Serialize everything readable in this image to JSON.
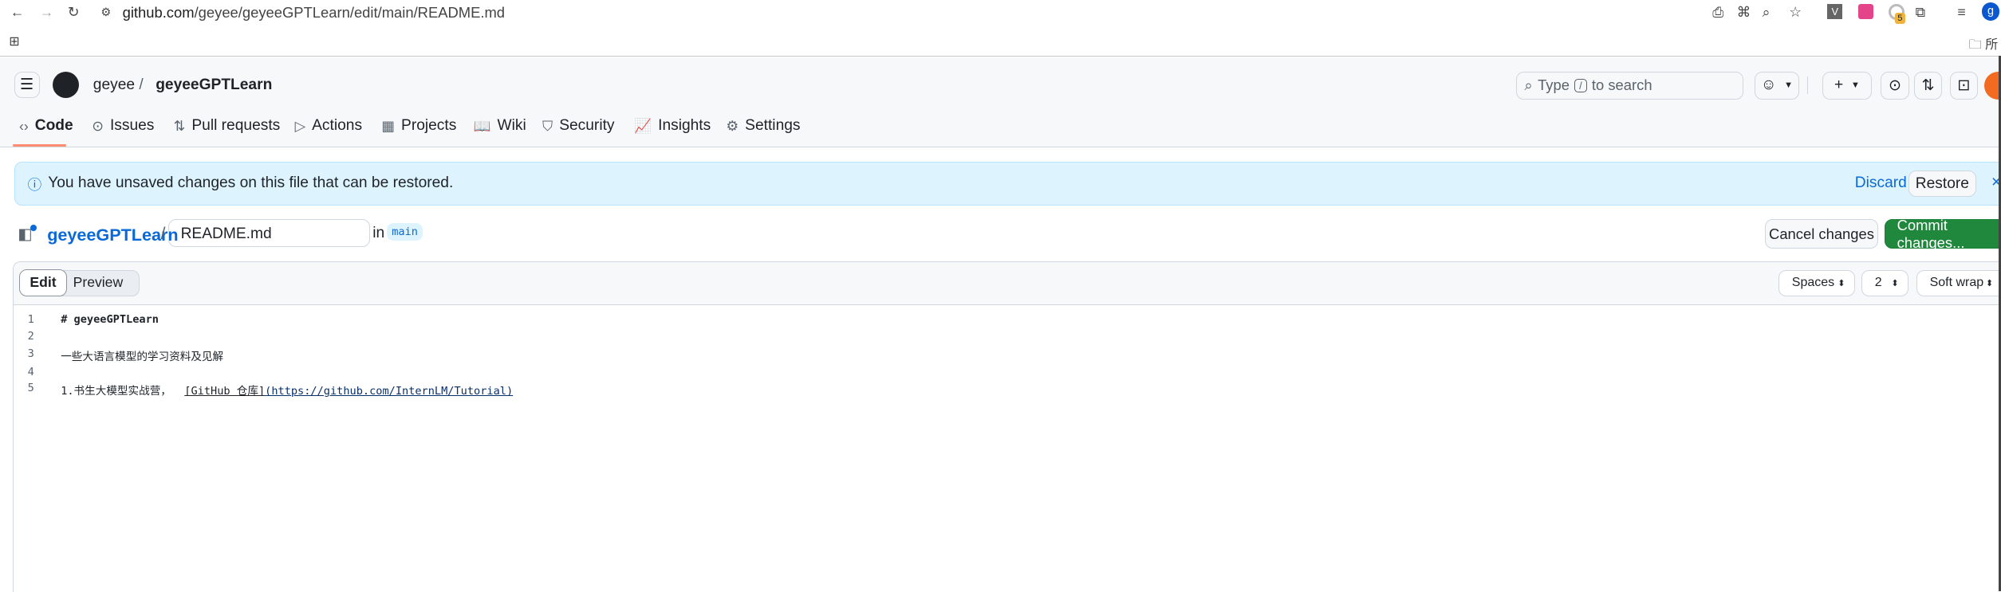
{
  "browser": {
    "url_host": "github.com",
    "url_path": "/geyee/geyeeGPTLearn/edit/main/README.md",
    "ext_v": "V",
    "ext_badge": "5",
    "profile": "g",
    "bookmark_folder": "所有"
  },
  "header": {
    "owner": "geyee",
    "sep": "/",
    "repo": "geyeeGPTLearn",
    "search_pre": "Type",
    "search_key": "/",
    "search_post": "to search"
  },
  "tabs": [
    {
      "label": "Code",
      "icon": "code-icon"
    },
    {
      "label": "Issues",
      "icon": "issue-icon"
    },
    {
      "label": "Pull requests",
      "icon": "pull-request-icon"
    },
    {
      "label": "Actions",
      "icon": "play-icon"
    },
    {
      "label": "Projects",
      "icon": "table-icon"
    },
    {
      "label": "Wiki",
      "icon": "book-icon"
    },
    {
      "label": "Security",
      "icon": "shield-icon"
    },
    {
      "label": "Insights",
      "icon": "graph-icon"
    },
    {
      "label": "Settings",
      "icon": "gear-icon"
    }
  ],
  "banner": {
    "message": "You have unsaved changes on this file that can be restored.",
    "discard": "Discard",
    "restore": "Restore"
  },
  "file": {
    "repo": "geyeeGPTLearn",
    "sep": "/",
    "filename": "README.md",
    "in": "in",
    "branch": "main",
    "cancel": "Cancel changes",
    "commit": "Commit changes..."
  },
  "editor": {
    "edit": "Edit",
    "preview": "Preview",
    "indent_mode": "Spaces",
    "indent_size": "2",
    "wrap": "Soft wrap",
    "lines": [
      {
        "n": "1",
        "text": "# geyeeGPTLearn"
      },
      {
        "n": "2",
        "text": ""
      },
      {
        "n": "3",
        "text": "一些大语言模型的学习资料及见解"
      },
      {
        "n": "4",
        "text": ""
      },
      {
        "n": "5",
        "pre": "1.书生大模型实战营，  ",
        "link_text": "[GitHub 仓库]",
        "link_url": "(https://github.com/InternLM/Tutorial)"
      }
    ]
  },
  "colors": {
    "accent": "#0969da",
    "commit": "#1f883d",
    "banner_bg": "#ddf4ff",
    "tab_underline": "#fd8c73"
  }
}
